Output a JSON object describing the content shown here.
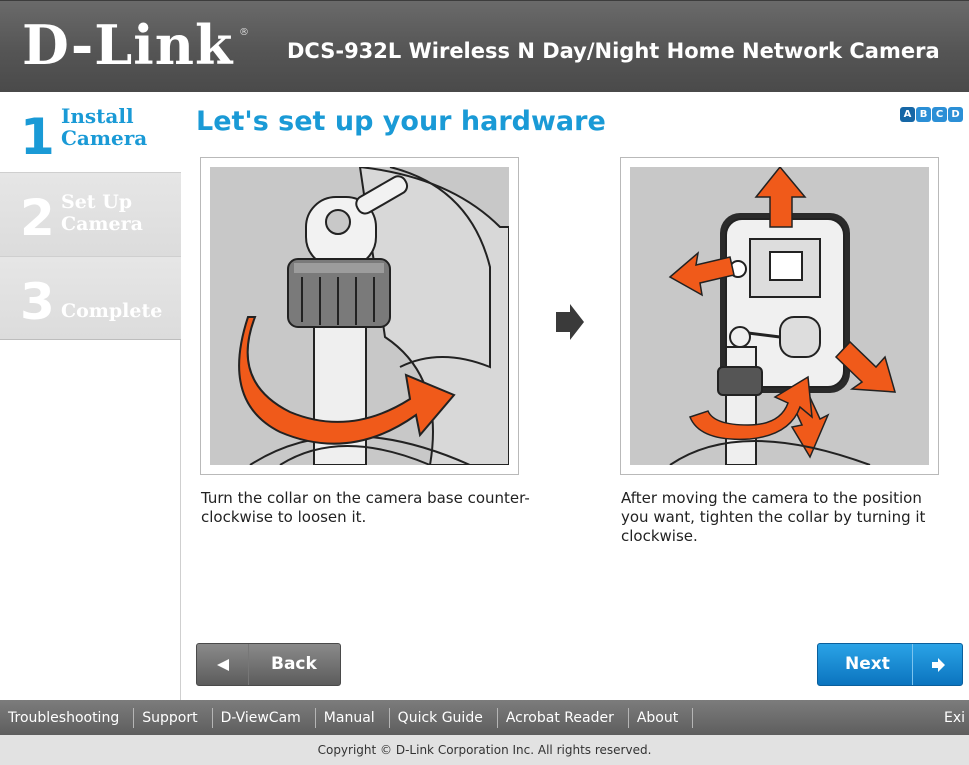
{
  "header": {
    "logo": "D-Link",
    "registered_mark": "®",
    "product_title": "DCS-932L  Wireless N Day/Night Home Network Camera"
  },
  "sidebar": {
    "steps": [
      {
        "number": "1",
        "line1": "Install",
        "line2": "Camera",
        "state": "active"
      },
      {
        "number": "2",
        "line1": "Set Up",
        "line2": "Camera",
        "state": "inactive"
      },
      {
        "number": "3",
        "line1": "Complete",
        "line2": "",
        "state": "inactive"
      }
    ]
  },
  "main": {
    "title": "Let's set up your hardware",
    "substeps": [
      "A",
      "B",
      "C",
      "D"
    ],
    "figure1": {
      "icon": "camera-collar-loosen-illustration"
    },
    "figure2": {
      "icon": "camera-reposition-tighten-illustration"
    },
    "caption1": "Turn the collar on the camera base counter-clockwise to loosen it.",
    "caption2": "After moving the camera to the position you want, tighten the collar by turning it clockwise."
  },
  "buttons": {
    "back_label": "Back",
    "next_label": "Next"
  },
  "footer": {
    "links": [
      "Troubleshooting",
      "Support",
      "D-ViewCam",
      "Manual",
      "Quick Guide",
      "Acrobat Reader",
      "About"
    ],
    "exit_label": "Exi",
    "copyright": "Copyright © D-Link Corporation Inc. All rights reserved."
  },
  "colors": {
    "accent_blue": "#1a9ad6",
    "arrow_orange": "#f05a1a",
    "header_gray": "#555555"
  }
}
